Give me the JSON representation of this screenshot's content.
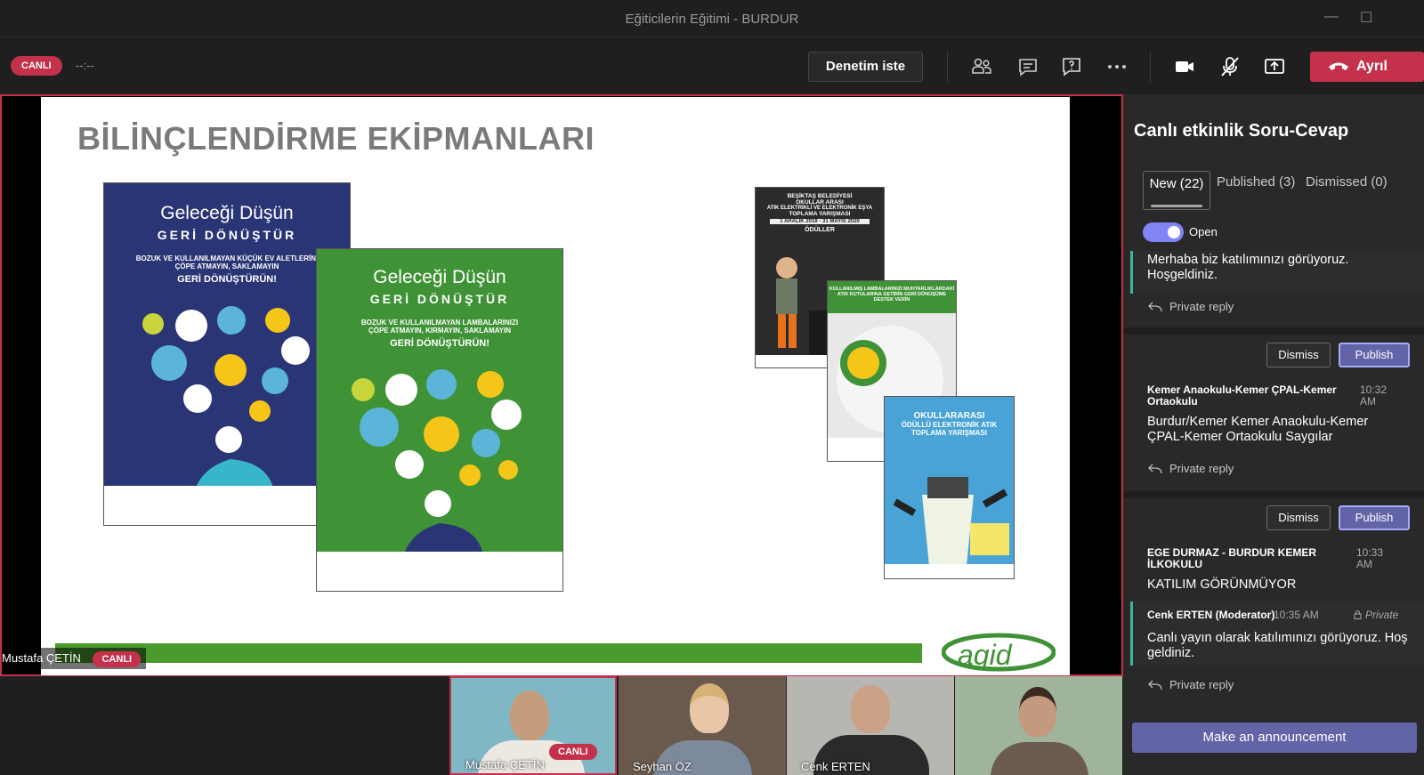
{
  "window": {
    "title": "Eğiticilerin Eğitimi - BURDUR",
    "minimize_glyph": "—",
    "maximize_glyph": "☐"
  },
  "toolbar": {
    "live_badge": "CANLI",
    "timer": "--:--",
    "help_button": "Denetim iste",
    "leave_button": "Ayrıl",
    "icons": [
      "participants-icon",
      "chat-icon",
      "qna-icon",
      "more-icon",
      "camera-icon",
      "mic-off-icon",
      "share-icon",
      "hangup-icon"
    ]
  },
  "slide": {
    "title": "BİLİNÇLENDİRME EKİPMANLARI",
    "poster_blue": {
      "line1": "Geleceği Düşün",
      "line2": "GERİ DÖNÜŞTÜR",
      "line3": "BOZUK VE KULLANILMAYAN KÜÇÜK EV ALETLERİNİ",
      "line4": "ÇÖPE ATMAYIN, SAKLAMAYIN",
      "line5": "GERİ DÖNÜŞTÜRÜN!"
    },
    "poster_green": {
      "line1": "Geleceği Düşün",
      "line2": "GERİ DÖNÜŞTÜR",
      "line3": "BOZUK VE KULLANILMAYAN LAMBALARINIZI",
      "line4": "ÇÖPE ATMAYIN, KIRMAYIN, SAKLAMAYIN",
      "line5": "GERİ DÖNÜŞTÜRÜN!"
    },
    "poster_small1": {
      "line1": "BEŞİKTAŞ BELEDİYESİ",
      "line2": "OKULLAR ARASI",
      "line3": "ATIK ELEKTRİKLİ VE ELEKTRONİK EŞYA",
      "line4": "TOPLAMA YARIŞMASI",
      "line5": "1 ARALIK 2019 - 31 MAYIS 2020",
      "line6": "ÖDÜLLER"
    },
    "poster_small2": {
      "line1": "KULLANILMIŞ LAMBALARINIZI MUHTARLIKLARDAKİ",
      "line2": "ATIK KUTULARINA GETİRİN GERİ DÖNÜŞÜME",
      "line3": "DESTEK VERİN"
    },
    "poster_small3": {
      "line1": "OKULLARARASI",
      "line2": "ÖDÜLLÜ ELEKTRONİK ATIK",
      "line3": "TOPLAMA YARIŞMASI"
    },
    "logo": "agid",
    "presenter_name": "Mustafa ÇETİN",
    "presenter_badge": "CANLI"
  },
  "thumbnails": [
    {
      "name": "Mustafa ÇETİN",
      "badge": "CANLI"
    },
    {
      "name": "Seyhan ÖZ"
    },
    {
      "name": "Cenk ERTEN"
    },
    {
      "name": ""
    }
  ],
  "panel": {
    "title": "Canlı etkinlik Soru-Cevap",
    "tabs": [
      "New (22)",
      "Published (3)",
      "Dismissed (0)"
    ],
    "toggle_label": "Open",
    "questions": [
      {
        "text": "Merhaba biz katılımınızı görüyoruz. Hoşgeldiniz.",
        "reply": "Private reply"
      },
      {
        "dismiss": "Dismiss",
        "publish": "Publish",
        "sender": "Kemer Anaokulu-Kemer ÇPAL-Kemer Ortaokulu",
        "time": "10:32 AM",
        "text": "Burdur/Kemer Kemer Anaokulu-Kemer ÇPAL-Kemer Ortaokulu Saygılar",
        "reply": "Private reply"
      },
      {
        "dismiss": "Dismiss",
        "publish": "Publish",
        "sender": "EGE DURMAZ - BURDUR KEMER İLKOKULU",
        "time": "10:33 AM",
        "text": "KATILIM GÖRÜNMÜYOR",
        "moderator": "Cenk ERTEN (Moderator)",
        "moderator_time": "10:35 AM",
        "private_tag": "Private",
        "moderator_text": "Canlı yayın olarak katılımınızı görüyoruz. Hoş geldiniz.",
        "reply": "Private reply"
      }
    ],
    "announce_button": "Make an announcement"
  }
}
